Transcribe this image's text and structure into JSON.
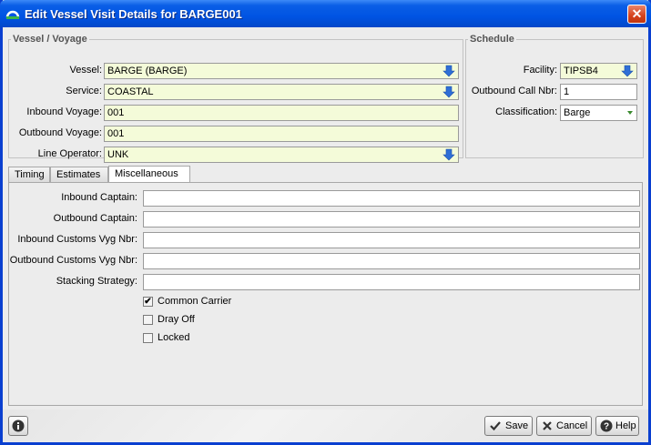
{
  "window": {
    "title": "Edit Vessel Visit Details for BARGE001",
    "close_glyph": "✕"
  },
  "vessel_voyage": {
    "legend": "Vessel / Voyage",
    "vessel": {
      "label": "Vessel:",
      "value": "BARGE (BARGE)"
    },
    "service": {
      "label": "Service:",
      "value": "COASTAL"
    },
    "inbound_voyage": {
      "label": "Inbound Voyage:",
      "value": "001"
    },
    "outbound_voyage": {
      "label": "Outbound Voyage:",
      "value": "001"
    },
    "line_operator": {
      "label": "Line Operator:",
      "value": "UNK"
    }
  },
  "schedule": {
    "legend": "Schedule",
    "facility": {
      "label": "Facility:",
      "value": "TIPSB4"
    },
    "outbound_call_nbr": {
      "label": "Outbound Call Nbr:",
      "value": "1"
    },
    "classification": {
      "label": "Classification:",
      "value": "Barge"
    }
  },
  "tabs": [
    {
      "label": "Timing",
      "active": false
    },
    {
      "label": "Estimates",
      "active": false
    },
    {
      "label": "Miscellaneous",
      "active": true
    }
  ],
  "misc": {
    "inbound_captain": {
      "label": "Inbound Captain:",
      "value": ""
    },
    "outbound_captain": {
      "label": "Outbound Captain:",
      "value": ""
    },
    "inbound_customs": {
      "label": "Inbound Customs Vyg Nbr:",
      "value": ""
    },
    "outbound_customs": {
      "label": "Outbound Customs Vyg Nbr:",
      "value": ""
    },
    "stacking_strategy": {
      "label": "Stacking Strategy:",
      "value": ""
    },
    "common_carrier": {
      "label": "Common Carrier",
      "checked": true,
      "mark": "✔"
    },
    "dray_off": {
      "label": "Dray Off",
      "checked": false,
      "mark": ""
    },
    "locked": {
      "label": "Locked",
      "checked": false,
      "mark": ""
    }
  },
  "footer": {
    "save_label": "Save",
    "cancel_label": "Cancel",
    "help_label": "Help"
  },
  "colors": {
    "required_field_bg": "#f4fbd9",
    "title_bar": "#0054e3",
    "dropdown_arrow": "#2f6fd6"
  }
}
